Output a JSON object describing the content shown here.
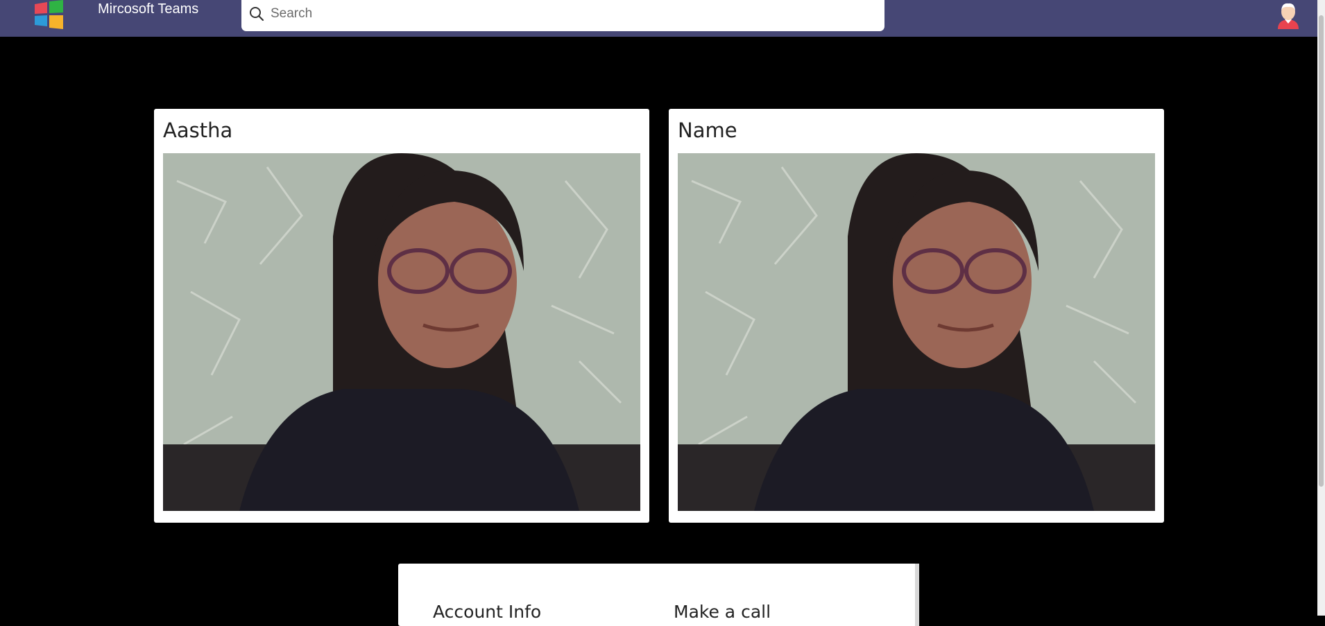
{
  "header": {
    "app_title": "Mircosoft Teams",
    "search_placeholder": "Search",
    "search_value": "",
    "logo_icon": "windows-logo-icon",
    "avatar_icon": "user-avatar-icon",
    "background_color": "#464775"
  },
  "videos": [
    {
      "name": "Aastha"
    },
    {
      "name": "Name"
    }
  ],
  "panel": {
    "account_info": "Account Info",
    "make_a_call": "Make a call"
  }
}
